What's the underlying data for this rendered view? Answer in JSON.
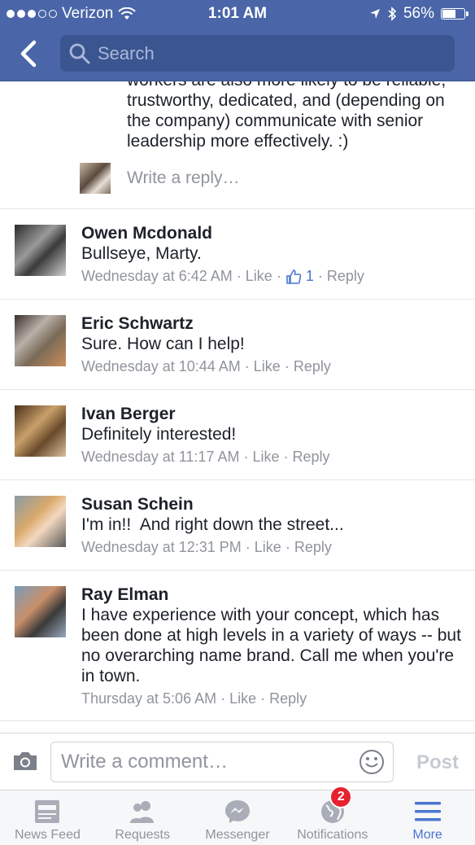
{
  "status_bar": {
    "carrier": "Verizon",
    "time": "1:01 AM",
    "battery": "56%",
    "battery_level": 0.56
  },
  "header": {
    "search_placeholder": "Search"
  },
  "thread": {
    "partial_text": "workers are also more likely to be reliable, trustworthy, dedicated, and (depending on the company) communicate with senior leadership more effectively. :)",
    "reply_placeholder": "Write a reply…"
  },
  "comments": [
    {
      "name": "Owen Mcdonald",
      "text": "Bullseye, Marty.",
      "time": "Wednesday at 6:42 AM",
      "like": "Like",
      "reply": "Reply",
      "like_count": "1"
    },
    {
      "name": "Eric Schwartz",
      "text": "Sure. How can I help!",
      "time": "Wednesday at 10:44 AM",
      "like": "Like",
      "reply": "Reply"
    },
    {
      "name": "Ivan Berger",
      "text": "Definitely interested!",
      "time": "Wednesday at 11:17 AM",
      "like": "Like",
      "reply": "Reply"
    },
    {
      "name": "Susan Schein",
      "text": "I'm in!!  And right down the street...",
      "time": "Wednesday at 12:31 PM",
      "like": "Like",
      "reply": "Reply"
    },
    {
      "name": "Ray Elman",
      "text": "I have experience with your concept, which has been done at high levels in a variety of ways -- but no overarching name brand. Call me when you're in town.",
      "time": "Thursday at 5:06 AM",
      "like": "Like",
      "reply": "Reply"
    }
  ],
  "composer": {
    "placeholder": "Write a comment…",
    "post_label": "Post"
  },
  "tabbar": {
    "tabs": [
      {
        "label": "News Feed",
        "icon": "news-feed-icon"
      },
      {
        "label": "Requests",
        "icon": "friends-icon"
      },
      {
        "label": "Messenger",
        "icon": "messenger-icon"
      },
      {
        "label": "Notifications",
        "icon": "globe-icon",
        "badge": "2"
      },
      {
        "label": "More",
        "icon": "menu-icon",
        "active": true
      }
    ]
  },
  "colors": {
    "header": "#4a65a8",
    "link_active": "#4a76d1",
    "badge": "#e8212f",
    "meta": "#90949c"
  }
}
